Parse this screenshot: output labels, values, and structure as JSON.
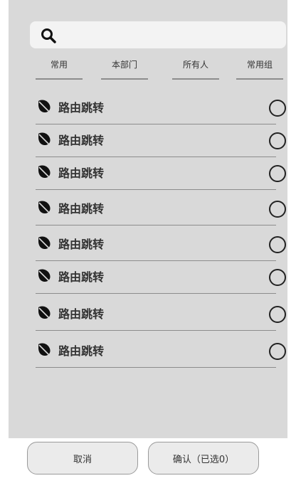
{
  "search": {
    "placeholder": "",
    "icon": "search-icon"
  },
  "tabs": [
    {
      "label": "常用"
    },
    {
      "label": "本部门"
    },
    {
      "label": "所有人"
    },
    {
      "label": "常用组"
    }
  ],
  "list": {
    "items": [
      {
        "label": "路由跳转",
        "icon": "leaf-icon",
        "selected": false
      },
      {
        "label": "路由跳转",
        "icon": "leaf-icon",
        "selected": false
      },
      {
        "label": "路由跳转",
        "icon": "leaf-icon",
        "selected": false
      },
      {
        "label": "路由跳转",
        "icon": "leaf-icon",
        "selected": false
      },
      {
        "label": "路由跳转",
        "icon": "leaf-icon",
        "selected": false
      },
      {
        "label": "路由跳转",
        "icon": "leaf-icon",
        "selected": false
      },
      {
        "label": "路由跳转",
        "icon": "leaf-icon",
        "selected": false
      },
      {
        "label": "路由跳转",
        "icon": "leaf-icon",
        "selected": false
      }
    ]
  },
  "footer": {
    "cancel_label": "取消",
    "confirm_label": "确认（已选0）"
  },
  "colors": {
    "panel_bg": "#d9d9d9",
    "search_bg": "#f3f3f3",
    "divider": "#8c8c8c"
  }
}
